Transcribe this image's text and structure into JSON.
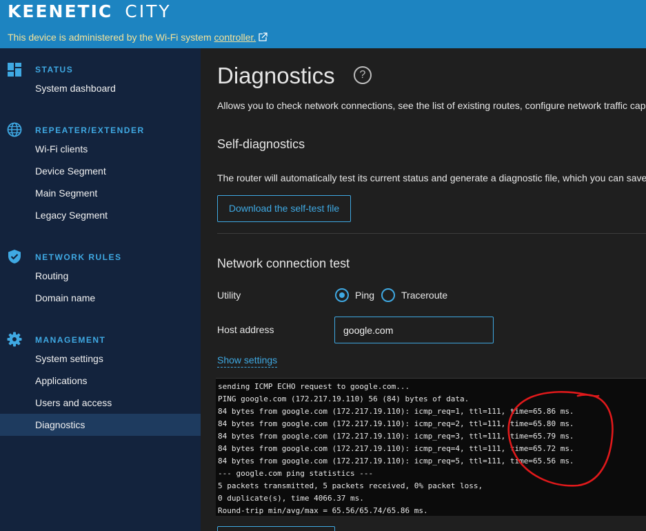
{
  "header": {
    "brand_main": "KEENETIC",
    "brand_sub": "CITY",
    "admin_message": "This device is administered by the Wi-Fi system ",
    "admin_link": "controller."
  },
  "sidebar": {
    "groups": [
      {
        "title": "STATUS",
        "icon": "dashboard-icon",
        "items": [
          "System dashboard"
        ]
      },
      {
        "title": "REPEATER/EXTENDER",
        "icon": "globe-icon",
        "items": [
          "Wi-Fi clients",
          "Device Segment",
          "Main Segment",
          "Legacy Segment"
        ]
      },
      {
        "title": "NETWORK RULES",
        "icon": "shield-icon",
        "items": [
          "Routing",
          "Domain name"
        ]
      },
      {
        "title": "MANAGEMENT",
        "icon": "gear-icon",
        "items": [
          "System settings",
          "Applications",
          "Users and access",
          "Diagnostics"
        ]
      }
    ],
    "active_item": "Diagnostics"
  },
  "main": {
    "title": "Diagnostics",
    "help_symbol": "?",
    "description": "Allows you to check network connections, see the list of existing routes, configure network traffic cap",
    "self_diag": {
      "title": "Self-diagnostics",
      "description": "The router will automatically test its current status and generate a diagnostic file, which you can save",
      "button": "Download the self-test file"
    },
    "net_test": {
      "title": "Network connection test",
      "utility_label": "Utility",
      "options": [
        "Ping",
        "Traceroute"
      ],
      "selected_option": "Ping",
      "host_label": "Host address",
      "host_value": "google.com",
      "show_settings": "Show settings",
      "console_lines": [
        "sending ICMP ECHO request to google.com...",
        "PING google.com (172.217.19.110) 56 (84) bytes of data.",
        "84 bytes from google.com (172.217.19.110): icmp_req=1, ttl=111, time=65.86 ms.",
        "84 bytes from google.com (172.217.19.110): icmp_req=2, ttl=111, time=65.80 ms.",
        "84 bytes from google.com (172.217.19.110): icmp_req=3, ttl=111, time=65.79 ms.",
        "84 bytes from google.com (172.217.19.110): icmp_req=4, ttl=111, time=65.72 ms.",
        "84 bytes from google.com (172.217.19.110): icmp_req=5, ttl=111, time=65.56 ms.",
        "--- google.com ping statistics ---",
        "5 packets transmitted, 5 packets received, 0% packet loss,",
        "0 duplicate(s), time 4066.37 ms.",
        "Round-trip min/avg/max = 65.56/65.74/65.86 ms."
      ]
    }
  },
  "colors": {
    "header_bg": "#1d84c1",
    "sidebar_bg": "#13233d",
    "accent": "#3fa9e3",
    "notice_text": "#f3e29a",
    "annotation": "#e0191b"
  }
}
